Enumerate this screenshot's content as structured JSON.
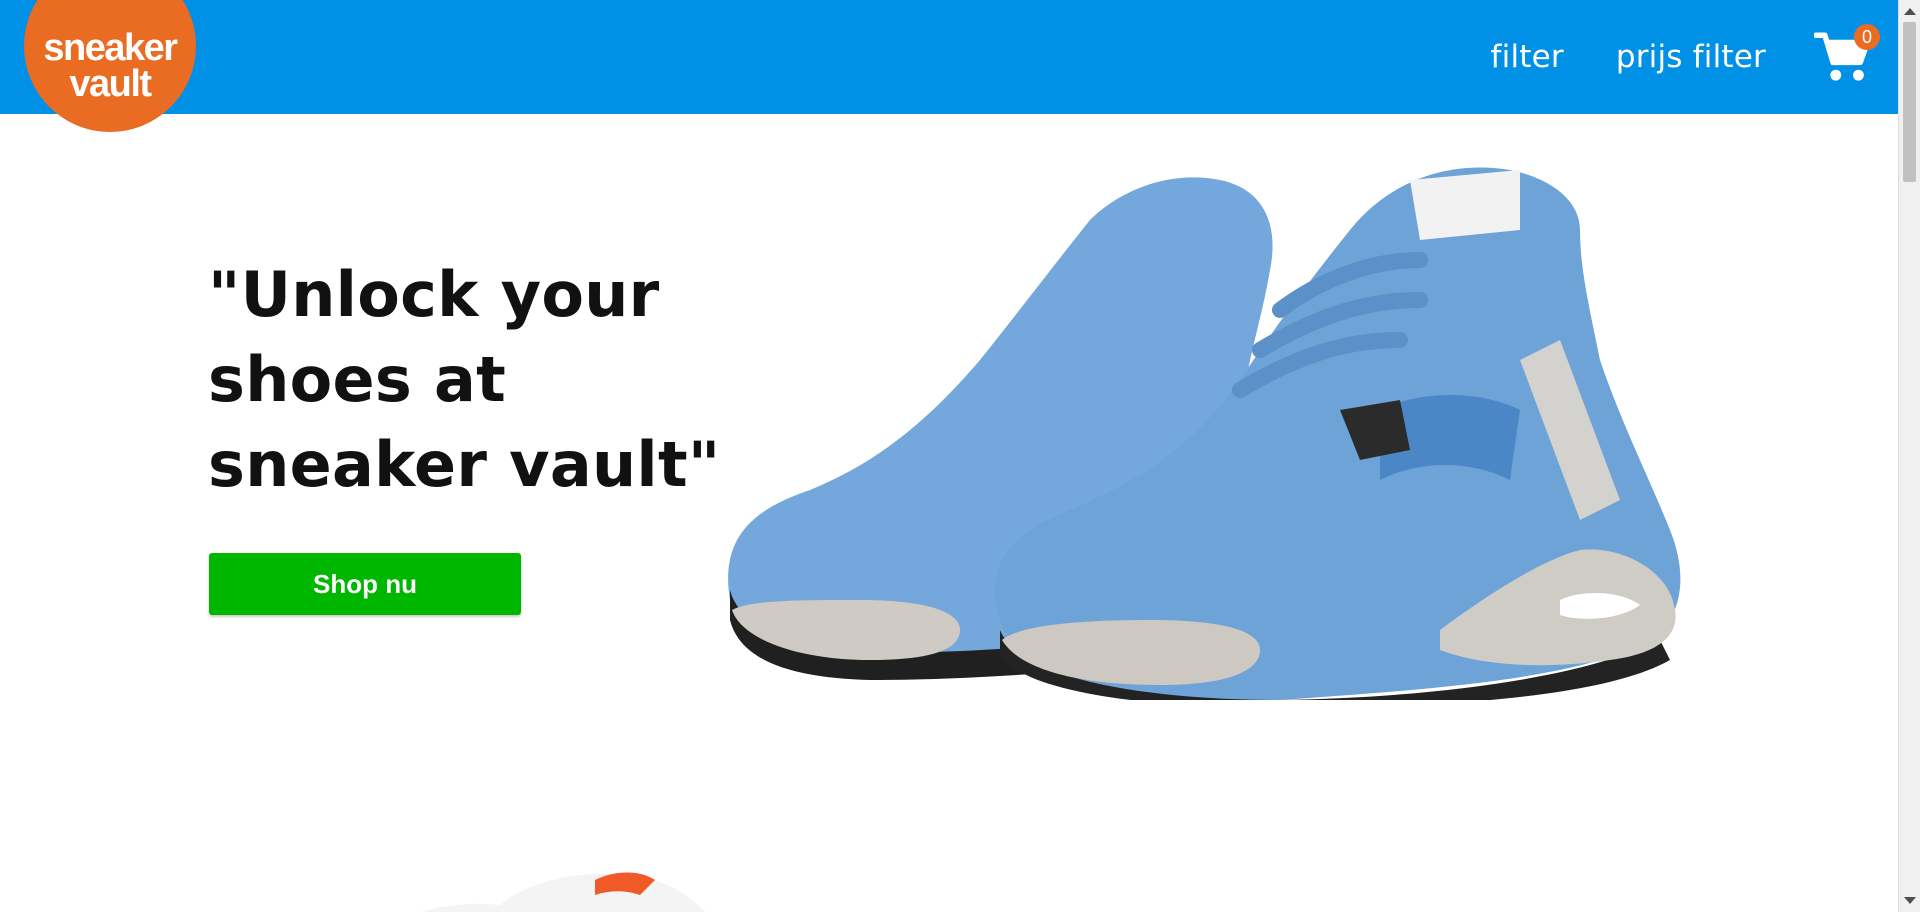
{
  "brand": {
    "line1": "sneaker",
    "line2": "vault",
    "logo_color": "#ea6b22"
  },
  "header": {
    "background": "#0090e6",
    "nav": {
      "filter_label": "filter",
      "price_filter_label": "prijs filter"
    },
    "cart": {
      "icon": "shopping-cart-icon",
      "count": "0"
    }
  },
  "hero": {
    "title": "\"Unlock your shoes at sneaker vault\"",
    "button_label": "Shop nu",
    "button_color": "#00b700",
    "image": "blue-sneakers-image"
  },
  "next_section": {
    "image": "white-orange-sneaker-image"
  }
}
